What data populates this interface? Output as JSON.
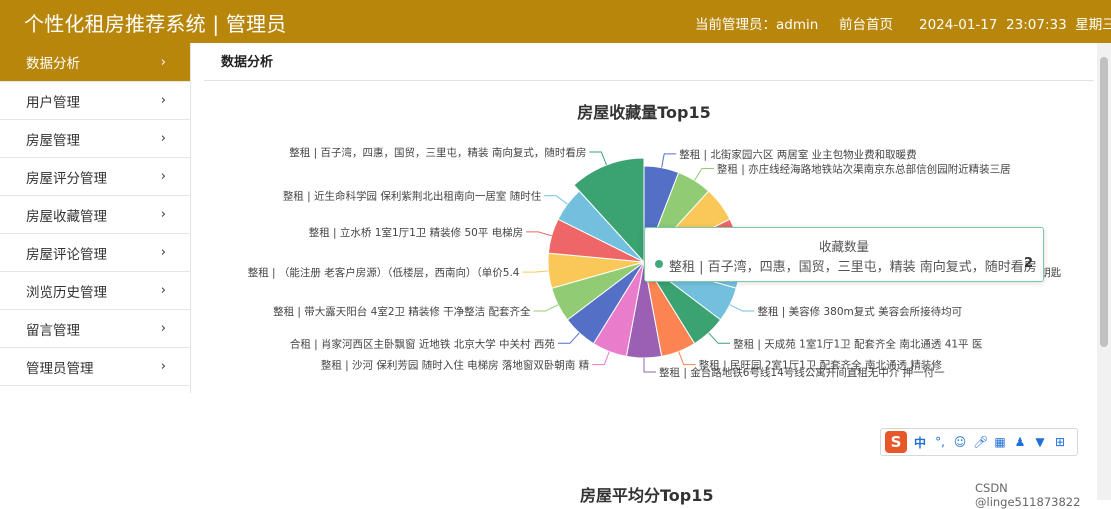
{
  "header": {
    "title": "个性化租房推荐系统 | 管理员",
    "admin_label": "当前管理员：admin",
    "home_link": "前台首页",
    "datetime": "2024-01-17  23:07:33  星期三"
  },
  "sidebar": {
    "items": [
      {
        "label": "数据分析"
      },
      {
        "label": "用户管理"
      },
      {
        "label": "房屋管理"
      },
      {
        "label": "房屋评分管理"
      },
      {
        "label": "房屋收藏管理"
      },
      {
        "label": "房屋评论管理"
      },
      {
        "label": "浏览历史管理"
      },
      {
        "label": "留言管理"
      },
      {
        "label": "管理员管理"
      }
    ],
    "chevron": "›"
  },
  "breadcrumb": "数据分析",
  "chart_data": [
    {
      "type": "pie",
      "title": "房屋收藏量Top15",
      "series_name": "收藏数量",
      "slices": [
        {
          "name": "整租 | 北街家园六区 两居室 业主包物业费和取暖费",
          "value": 1,
          "color": "#5470c6"
        },
        {
          "name": "整租 | 亦庄线经海路地铁站次渠南京东总部信创园附近精装三居",
          "value": 1,
          "color": "#91cc75"
        },
        {
          "name": "",
          "value": 1,
          "color": "#fac858"
        },
        {
          "name": "",
          "value": 1,
          "color": "#ee6666"
        },
        {
          "name": "整租 | 昌平沙河大桥保利紫荆香谷北区南北通透3居99平有钥匙",
          "value": 1,
          "color": "#73c0de"
        },
        {
          "name": "整租 | 美容修 380m复式 美容会所接待均可",
          "value": 1,
          "color": "#73c0de"
        },
        {
          "name": "整租 | 天成苑 1室1厅1卫 配套齐全 南北通透 41平 医",
          "value": 1,
          "color": "#3ba272"
        },
        {
          "name": "整租 | 民旺园 2室1厅1卫 配套齐全 南北通透 精装修",
          "value": 1,
          "color": "#fc8452"
        },
        {
          "name": "整租 | 金台路地铁6号线14号线公寓开间直租无中介 押一付一",
          "value": 1,
          "color": "#9a60b4"
        },
        {
          "name": "整租 | 沙河 保利芳园 随时入住 电梯房 落地窗双卧朝南 精",
          "value": 1,
          "color": "#ea7ccc"
        },
        {
          "name": "合租 | 肖家河西区主卧飘窗 近地铁 北京大学 中关村 西苑",
          "value": 1,
          "color": "#5470c6"
        },
        {
          "name": "整租 | 带大露天阳台 4室2卫 精装修 干净整洁 配套齐全",
          "value": 1,
          "color": "#91cc75"
        },
        {
          "name": "整租 | （能注册 老客户房源）（低楼层，西南向）（单价5.4",
          "value": 1,
          "color": "#fac858"
        },
        {
          "name": "整租 | 立水桥 1室1厅1卫 精装修 50平 电梯房",
          "value": 1,
          "color": "#ee6666"
        },
        {
          "name": "整租 | 近生命科学园 保利紫荆北出租南向一居室 随时住",
          "value": 1,
          "color": "#73c0de"
        },
        {
          "name": "整租 | 百子湾，四惠，国贸，三里屯，精装 南向复式，随时看房",
          "value": 2,
          "color": "#3ba272"
        }
      ]
    }
  ],
  "tooltip": {
    "title": "收藏数量",
    "label": "整租 | 百子湾，四惠，国贸，三里屯，精装 南向复式，随时看房",
    "value": "2"
  },
  "second_chart_title": "房屋平均分Top15",
  "ime": {
    "logo": "S",
    "lang": "中"
  },
  "watermark": "CSDN @linge511873822"
}
